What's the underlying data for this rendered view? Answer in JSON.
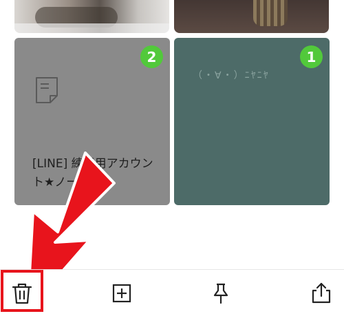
{
  "notes": [
    {
      "badge": "2",
      "title": "[LINE] 練習用アカウント★ノート....",
      "type": "note",
      "bg": "#8a8a8a"
    },
    {
      "badge": "1",
      "text": "（・∀・）ﾆﾔﾆﾔ",
      "type": "memo",
      "bg": "#4d6b68"
    }
  ],
  "toolbar": {
    "delete": "trash-icon",
    "add": "add-square-icon",
    "pin": "pin-icon",
    "share": "share-icon"
  },
  "colors": {
    "badge": "#52c93b",
    "annotation": "#e8141c"
  }
}
